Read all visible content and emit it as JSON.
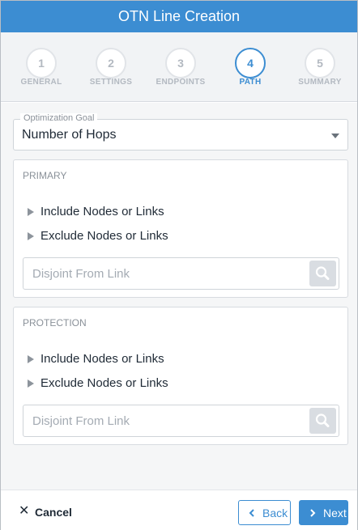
{
  "header": {
    "title": "OTN Line Creation"
  },
  "steps": [
    {
      "number": "1",
      "label": "GENERAL"
    },
    {
      "number": "2",
      "label": "SETTINGS"
    },
    {
      "number": "3",
      "label": "ENDPOINTS"
    },
    {
      "number": "4",
      "label": "PATH"
    },
    {
      "number": "5",
      "label": "SUMMARY"
    }
  ],
  "active_step": "4",
  "colors": {
    "accent": "#3c8dd2",
    "muted": "#b3b9c1",
    "background": "#f5f6f7"
  },
  "optimization_goal": {
    "label": "Optimization Goal",
    "value": "Number of Hops",
    "icon": "chevron-down-icon"
  },
  "primary": {
    "title": "PRIMARY",
    "include_label": "Include Nodes or Links",
    "exclude_label": "Exclude Nodes or Links",
    "disjoint_placeholder": "Disjoint From Link"
  },
  "protection": {
    "title": "PROTECTION",
    "include_label": "Include Nodes or Links",
    "exclude_label": "Exclude Nodes or Links",
    "disjoint_placeholder": "Disjoint From Link"
  },
  "footer": {
    "cancel_label": "Cancel",
    "back_label": "Back",
    "next_label": "Next"
  },
  "icons": {
    "search": "search-icon",
    "close": "close-icon",
    "back": "chevron-left-icon",
    "next": "chevron-right-icon",
    "expand": "caret-right-icon"
  }
}
